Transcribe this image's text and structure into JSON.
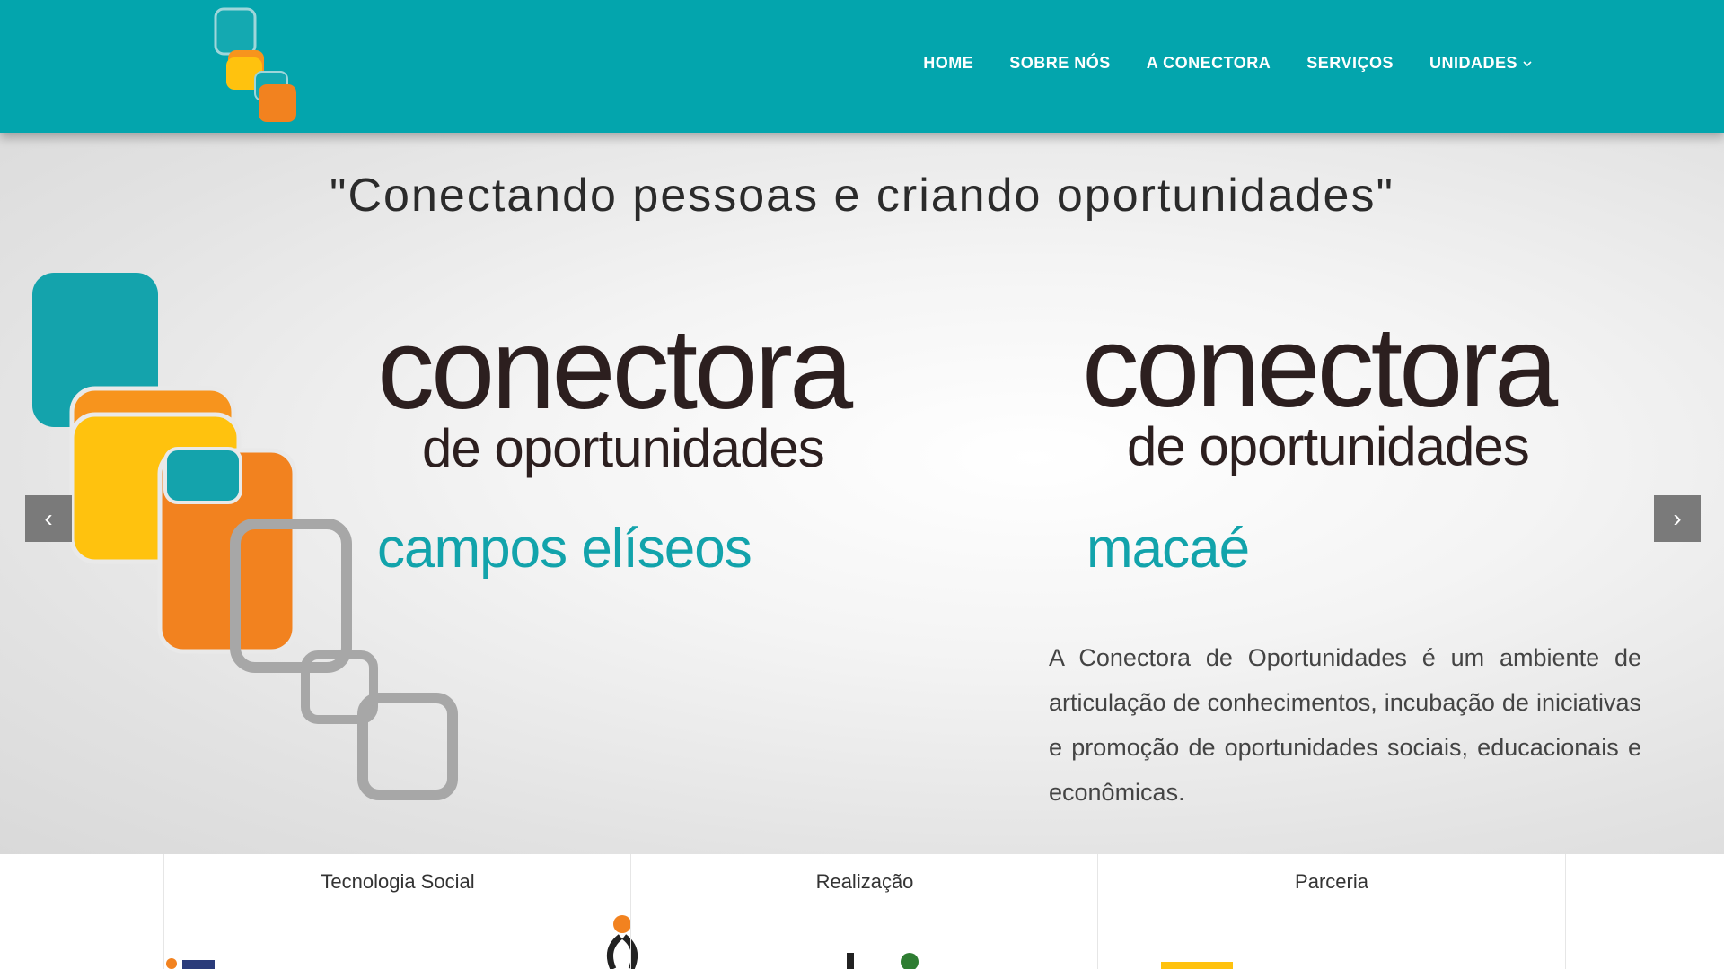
{
  "header": {
    "logo_icon": "conectora-logo-icon",
    "nav": [
      {
        "label": "HOME"
      },
      {
        "label": "SOBRE NÓS"
      },
      {
        "label": "A CONECTORA"
      },
      {
        "label": "SERVIÇOS"
      },
      {
        "label": "UNIDADES",
        "icon": "chevron-down-icon"
      }
    ]
  },
  "hero": {
    "tagline": "\"Conectando pessoas e criando oportunidades\"",
    "brand_1": {
      "big": "conectora",
      "small": "de oportunidades",
      "city": "campos elíseos"
    },
    "brand_2": {
      "big": "conectora",
      "small": "de oportunidades",
      "city": "macaé"
    },
    "description": "A Conectora de Oportunidades é um ambiente de articulação de conhecimentos, incubação de iniciativas e promoção de oportunidades sociais, educacionais e econômicas.",
    "prev_icon": "chevron-left-icon",
    "next_icon": "chevron-right-icon",
    "prev_glyph": "‹",
    "next_glyph": "›"
  },
  "sponsors": [
    {
      "title": "Tecnologia Social"
    },
    {
      "title": "Realização"
    },
    {
      "title": "Parceria"
    }
  ],
  "colors": {
    "header": "#03a5ad",
    "teal": "#12a3ab",
    "orange": "#f2821f",
    "yellow": "#ffc20e",
    "gray": "#a7a7a7",
    "dark": "#2c1f1f"
  }
}
